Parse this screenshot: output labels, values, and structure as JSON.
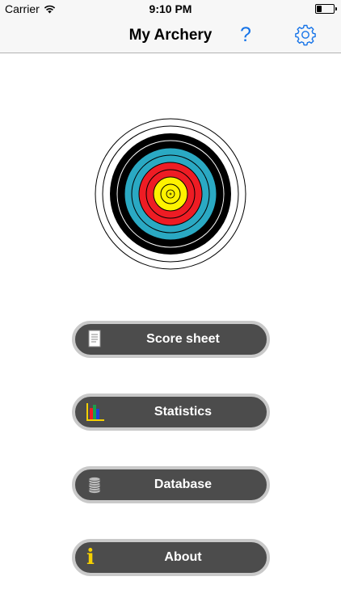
{
  "status_bar": {
    "carrier": "Carrier",
    "time": "9:10 PM",
    "wifi_icon": "wifi-icon",
    "battery_icon": "battery-icon",
    "battery_level": 0.3
  },
  "nav": {
    "title": "My Archery",
    "help_label": "?",
    "settings_icon": "gear-icon",
    "accent_color": "#1573e8"
  },
  "target": {
    "icon": "archery-target-icon",
    "ring_colors": {
      "white": "#ffffff",
      "black": "#000000",
      "blue": "#2aa9c3",
      "red": "#ee1c24",
      "gold": "#fff200"
    }
  },
  "menu": {
    "score_sheet": {
      "label": "Score sheet",
      "icon": "document-icon"
    },
    "statistics": {
      "label": "Statistics",
      "icon": "bar-chart-icon"
    },
    "database": {
      "label": "Database",
      "icon": "database-icon"
    },
    "about": {
      "label": "About",
      "icon": "info-icon",
      "glyph": "i"
    },
    "button_color": "#4c4c4c",
    "button_border_color": "#c9c9c9"
  }
}
